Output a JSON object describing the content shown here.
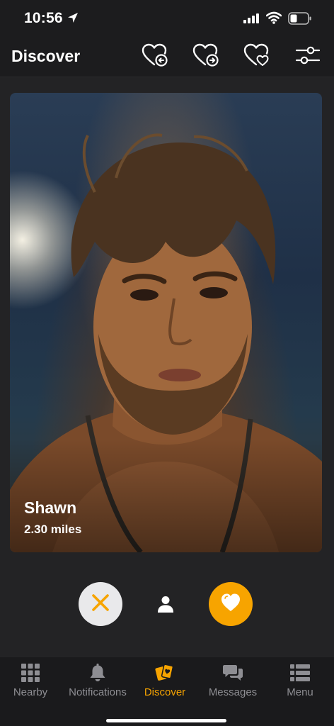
{
  "status_bar": {
    "time": "10:56"
  },
  "header": {
    "title": "Discover",
    "actions": [
      "heart-arrow-left-icon",
      "heart-arrow-right-icon",
      "heart-outline-icon",
      "filter-sliders-icon"
    ]
  },
  "profile": {
    "name": "Shawn",
    "distance": "2.30 miles"
  },
  "actions": {
    "pass_icon": "x-icon",
    "profile_icon": "person-icon",
    "like_icon": "heart-icon"
  },
  "tab_bar": {
    "tabs": [
      {
        "label": "Nearby",
        "icon": "grid-icon",
        "active": false
      },
      {
        "label": "Notifications",
        "icon": "bell-icon",
        "active": false
      },
      {
        "label": "Discover",
        "icon": "cards-icon",
        "active": true
      },
      {
        "label": "Messages",
        "icon": "chat-bubbles-icon",
        "active": false
      },
      {
        "label": "Menu",
        "icon": "list-icon",
        "active": false
      }
    ]
  },
  "colors": {
    "accent": "#f7a400",
    "background": "#1c1c1e",
    "content_background": "#232325",
    "inactive": "#8e8e93"
  }
}
